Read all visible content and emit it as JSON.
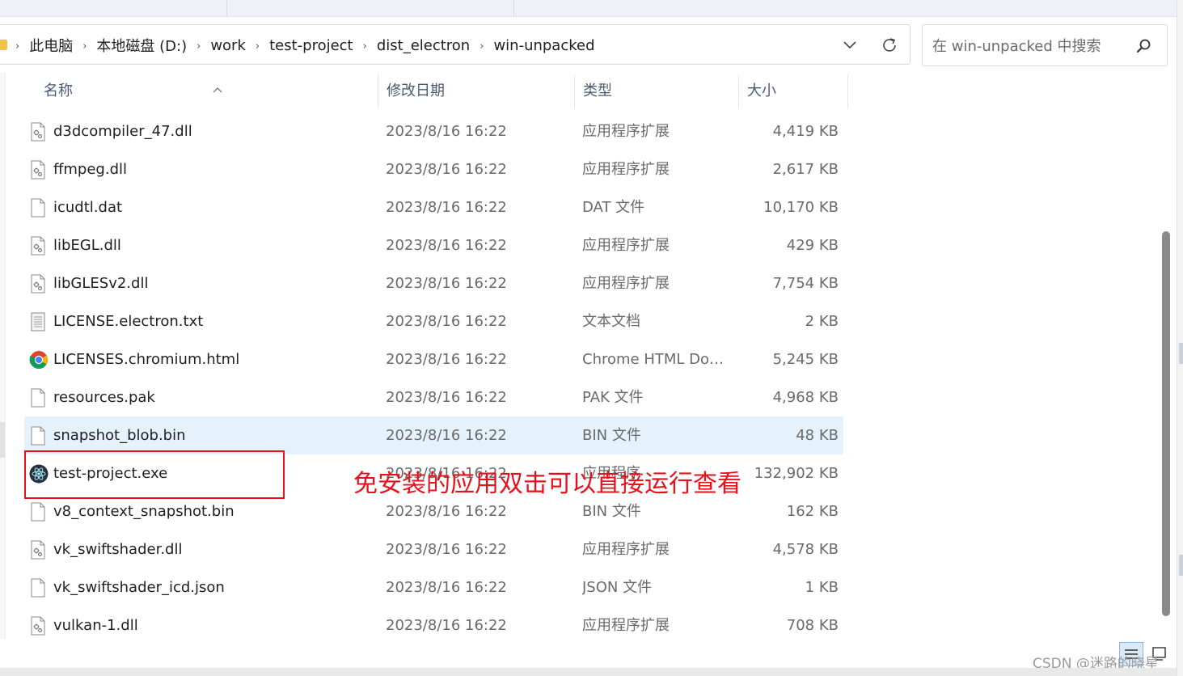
{
  "breadcrumb": [
    "此电脑",
    "本地磁盘 (D:)",
    "work",
    "test-project",
    "dist_electron",
    "win-unpacked"
  ],
  "search": {
    "placeholder": "在 win-unpacked 中搜索"
  },
  "columns": {
    "name": "名称",
    "date": "修改日期",
    "type": "类型",
    "size": "大小"
  },
  "files": [
    {
      "name": "d3dcompiler_47.dll",
      "date": "2023/8/16 16:22",
      "type": "应用程序扩展",
      "size": "4,419 KB",
      "icon": "dll-file-icon"
    },
    {
      "name": "ffmpeg.dll",
      "date": "2023/8/16 16:22",
      "type": "应用程序扩展",
      "size": "2,617 KB",
      "icon": "dll-file-icon"
    },
    {
      "name": "icudtl.dat",
      "date": "2023/8/16 16:22",
      "type": "DAT 文件",
      "size": "10,170 KB",
      "icon": "blank-file-icon"
    },
    {
      "name": "libEGL.dll",
      "date": "2023/8/16 16:22",
      "type": "应用程序扩展",
      "size": "429 KB",
      "icon": "dll-file-icon"
    },
    {
      "name": "libGLESv2.dll",
      "date": "2023/8/16 16:22",
      "type": "应用程序扩展",
      "size": "7,754 KB",
      "icon": "dll-file-icon"
    },
    {
      "name": "LICENSE.electron.txt",
      "date": "2023/8/16 16:22",
      "type": "文本文档",
      "size": "2 KB",
      "icon": "text-file-icon"
    },
    {
      "name": "LICENSES.chromium.html",
      "date": "2023/8/16 16:22",
      "type": "Chrome HTML Doc...",
      "size": "5,245 KB",
      "icon": "chrome-icon"
    },
    {
      "name": "resources.pak",
      "date": "2023/8/16 16:22",
      "type": "PAK 文件",
      "size": "4,968 KB",
      "icon": "blank-file-icon"
    },
    {
      "name": "snapshot_blob.bin",
      "date": "2023/8/16 16:22",
      "type": "BIN 文件",
      "size": "48 KB",
      "icon": "blank-file-icon",
      "selected": true
    },
    {
      "name": "test-project.exe",
      "date": "2023/8/16 16:22",
      "type": "应用程序",
      "size": "132,902 KB",
      "icon": "electron-icon"
    },
    {
      "name": "v8_context_snapshot.bin",
      "date": "2023/8/16 16:22",
      "type": "BIN 文件",
      "size": "162 KB",
      "icon": "blank-file-icon"
    },
    {
      "name": "vk_swiftshader.dll",
      "date": "2023/8/16 16:22",
      "type": "应用程序扩展",
      "size": "4,578 KB",
      "icon": "dll-file-icon"
    },
    {
      "name": "vk_swiftshader_icd.json",
      "date": "2023/8/16 16:22",
      "type": "JSON 文件",
      "size": "1 KB",
      "icon": "blank-file-icon"
    },
    {
      "name": "vulkan-1.dll",
      "date": "2023/8/16 16:22",
      "type": "应用程序扩展",
      "size": "708 KB",
      "icon": "dll-file-icon"
    }
  ],
  "annotation": "免安装的应用双击可以直接运行查看",
  "watermark": "CSDN @迷路的晓星",
  "colors": {
    "selected_row": "#e5f1fb",
    "annotation_red": "#e8101a",
    "header_text": "#4a5a73"
  }
}
